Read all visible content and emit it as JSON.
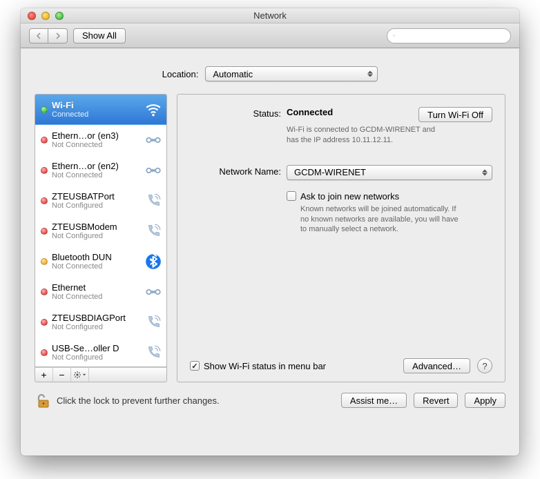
{
  "window": {
    "title": "Network"
  },
  "toolbar": {
    "show_all": "Show All",
    "search_placeholder": ""
  },
  "location": {
    "label": "Location:",
    "value": "Automatic"
  },
  "services": [
    {
      "name": "Wi-Fi",
      "status": "Connected",
      "dot": "green",
      "icon": "wifi",
      "selected": true
    },
    {
      "name": "Ethern…or (en3)",
      "status": "Not Connected",
      "dot": "red",
      "icon": "ethernet",
      "selected": false
    },
    {
      "name": "Ethern…or (en2)",
      "status": "Not Connected",
      "dot": "red",
      "icon": "ethernet",
      "selected": false
    },
    {
      "name": "ZTEUSBATPort",
      "status": "Not Configured",
      "dot": "red",
      "icon": "phone",
      "selected": false
    },
    {
      "name": "ZTEUSBModem",
      "status": "Not Configured",
      "dot": "red",
      "icon": "phone",
      "selected": false
    },
    {
      "name": "Bluetooth DUN",
      "status": "Not Connected",
      "dot": "orange",
      "icon": "bluetooth",
      "selected": false
    },
    {
      "name": "Ethernet",
      "status": "Not Connected",
      "dot": "red",
      "icon": "ethernet",
      "selected": false
    },
    {
      "name": "ZTEUSBDIAGPort",
      "status": "Not Configured",
      "dot": "red",
      "icon": "phone",
      "selected": false
    },
    {
      "name": "USB-Se…oller D",
      "status": "Not Configured",
      "dot": "red",
      "icon": "phone",
      "selected": false
    }
  ],
  "detail": {
    "status_label": "Status:",
    "status_value": "Connected",
    "wifi_toggle": "Turn Wi-Fi Off",
    "status_sub": "Wi-Fi is connected to GCDM-WIRENET and has the IP address 10.11.12.11.",
    "netname_label": "Network Name:",
    "netname_value": "GCDM-WIRENET",
    "ask_join": "Ask to join new networks",
    "ask_join_sub": "Known networks will be joined automatically. If no known networks are available, you will have to manually select a network.",
    "show_status": "Show Wi-Fi status in menu bar",
    "advanced": "Advanced…"
  },
  "footer": {
    "lock_text": "Click the lock to prevent further changes.",
    "assist": "Assist me…",
    "revert": "Revert",
    "apply": "Apply"
  }
}
